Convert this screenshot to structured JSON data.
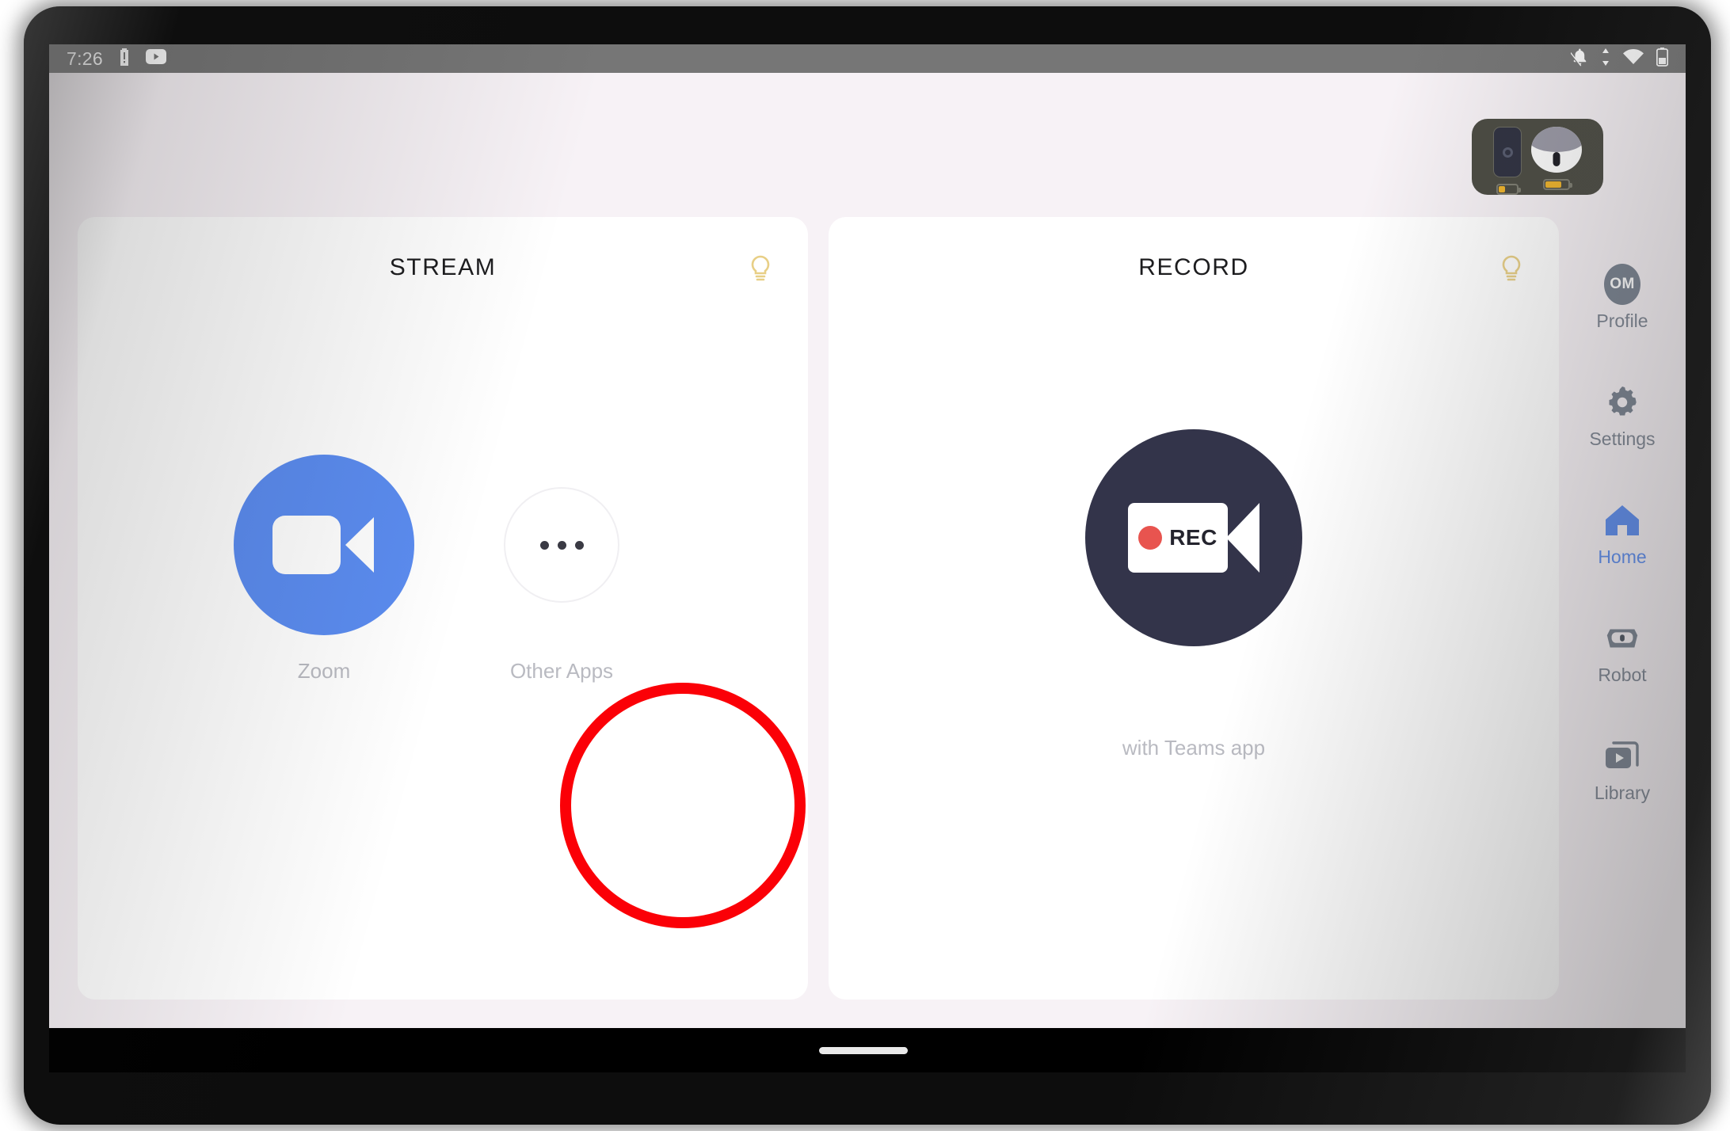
{
  "status_bar": {
    "time": "7:26",
    "left_icons": [
      "battery-alert-icon",
      "youtube-icon"
    ],
    "right_icons": [
      "notifications-off-icon",
      "data-transfer-icon",
      "wifi-icon",
      "battery-icon"
    ]
  },
  "device_widget": {
    "name": "device-battery-widget",
    "remote": {
      "label": "remote-controller",
      "battery_percent": 35
    },
    "robot": {
      "label": "robot-head",
      "battery_percent": 72
    },
    "battery_color": "#f0b429",
    "background": "#4a4a42"
  },
  "cards": [
    {
      "title": "STREAM",
      "hint_icon": "lightbulb-icon",
      "apps": [
        {
          "name": "zoom",
          "label": "Zoom",
          "icon": "zoom-video-icon",
          "color": "#5b8cf0"
        },
        {
          "name": "other-apps",
          "label": "Other Apps",
          "icon": "more-horizontal-icon",
          "highlighted": true
        }
      ],
      "subtitle": ""
    },
    {
      "title": "RECORD",
      "hint_icon": "lightbulb-icon",
      "apps": [
        {
          "name": "record",
          "label": "",
          "icon": "rec-camera-icon",
          "color": "#33344a",
          "badge_text": "REC"
        }
      ],
      "subtitle": "with Teams app"
    }
  ],
  "nav_rail": {
    "items": [
      {
        "name": "profile",
        "label": "Profile",
        "icon": "avatar-icon",
        "initials": "OM",
        "active": false
      },
      {
        "name": "settings",
        "label": "Settings",
        "icon": "gear-icon",
        "active": false
      },
      {
        "name": "home",
        "label": "Home",
        "icon": "home-icon",
        "active": true
      },
      {
        "name": "robot",
        "label": "Robot",
        "icon": "robot-icon",
        "active": false
      },
      {
        "name": "library",
        "label": "Library",
        "icon": "library-video-icon",
        "active": false
      }
    ],
    "active_color": "#5b8cf0",
    "inactive_color": "#7c8491"
  },
  "annotation": {
    "shape": "circle",
    "color": "#fb0007",
    "targets": "other-apps"
  },
  "system_nav": {
    "home_indicator": "home-indicator-pill"
  }
}
